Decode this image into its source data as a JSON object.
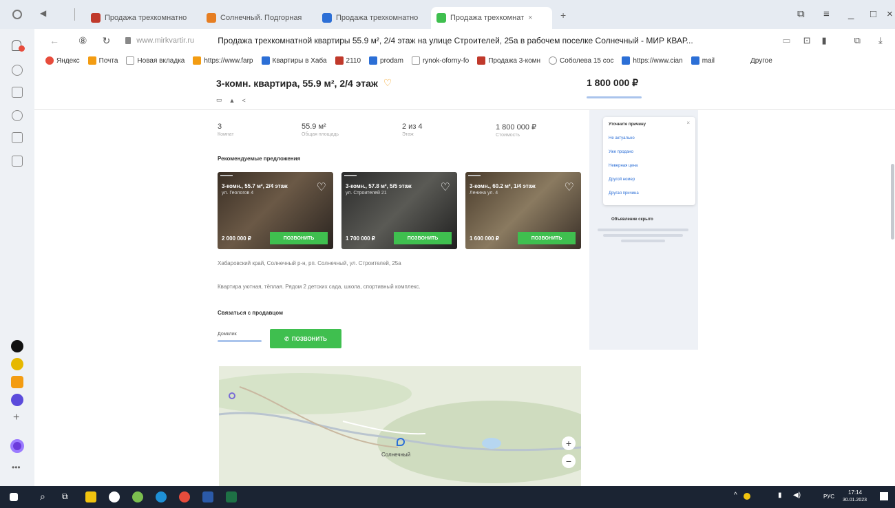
{
  "browser": {
    "tabs": [
      {
        "label": "Продажа трехкомнатно",
        "color": "#c0392b"
      },
      {
        "label": "Солнечный. Подгорная",
        "color": "#e67e22"
      },
      {
        "label": "Продажа трехкомнатно",
        "color": "#2c6fd6"
      },
      {
        "label": "Продажа трехкомнат",
        "color": "#3fbf4f"
      }
    ],
    "new_tab": "+",
    "url_domain": "www.mirkvartir.ru",
    "page_title": "Продажа трехкомнатной квартиры 55.9 м², 2/4 этаж на улице Строителей, 25а в рабочем поселке Солнечный - МИР КВАР...",
    "bookmarks": [
      {
        "label": "Яндекс",
        "color": "#e74c3c"
      },
      {
        "label": "Почта",
        "color": "#f39c12"
      },
      {
        "label": "Новая вкладка",
        "color": "#999999"
      },
      {
        "label": "https://www.farp",
        "color": "#f39c12"
      },
      {
        "label": "Квартиры в Хаба",
        "color": "#2c6fd6"
      },
      {
        "label": "2110",
        "color": "#c0392b"
      },
      {
        "label": "prodam",
        "color": "#2c6fd6"
      },
      {
        "label": "rynok-oforny-fo",
        "color": "#999999"
      },
      {
        "label": "Продажа 3-комн",
        "color": "#c0392b"
      },
      {
        "label": "Соболева 15 сос",
        "color": "#999999"
      },
      {
        "label": "https://www.cian",
        "color": "#2c6fd6"
      },
      {
        "label": "mail",
        "color": "#2c6fd6"
      }
    ],
    "bookmarks_more": "Другое"
  },
  "listing": {
    "heading": "3-комн. квартира, 55.9 м², 2/4 этаж",
    "price": "1 800 000 ₽",
    "stats": [
      {
        "value": "3",
        "label": "Комнат"
      },
      {
        "value": "55.9 м²",
        "label": "Общая площадь"
      },
      {
        "value": "2 из 4",
        "label": "Этаж"
      },
      {
        "value": "1 800 000 ₽",
        "label": "Стоимость"
      }
    ],
    "recommended_title": "Рекомендуемые предложения",
    "recommended": [
      {
        "title": "3-комн., 55.7 м², 2/4 этаж",
        "street": "ул. Геологов 4",
        "price": "2 000 000 ₽",
        "call": "ПОЗВОНИТЬ"
      },
      {
        "title": "3-комн., 57.8 м², 5/5 этаж",
        "street": "ул. Строителей 21",
        "price": "1 700 000 ₽",
        "call": "ПОЗВОНИТЬ"
      },
      {
        "title": "3-комн., 60.2 м², 1/4 этаж",
        "street": "Ленина ул. 4",
        "price": "1 600 000 ₽",
        "call": "ПОЗВОНИТЬ"
      }
    ],
    "address": "Хабаровский край, Солнечный р-н, рп. Солнечный, ул. Строителей, 25а",
    "description": "Квартира уютная, тёплая. Рядом 2 детских сада, школа, спортивный комплекс.",
    "contact_title": "Связаться с продавцом",
    "seller_label": "Домклик",
    "call_button": "ПОЗВОНИТЬ"
  },
  "sidebar": {
    "menu_title": "Уточните причину",
    "menu_items": [
      "Не актуально",
      "Уже продано",
      "Неверная цена",
      "Другой номер",
      "Другая причина"
    ],
    "hidden_title": "Объявление скрыто"
  },
  "map": {
    "place": "Солнечный",
    "zoom_in": "+",
    "zoom_out": "−"
  },
  "taskbar": {
    "lang": "РУС",
    "time": "17:14",
    "date": "30.01.2023"
  },
  "colors": {
    "accent_green": "#3fbf4f",
    "link_blue": "#2c6fd6"
  }
}
